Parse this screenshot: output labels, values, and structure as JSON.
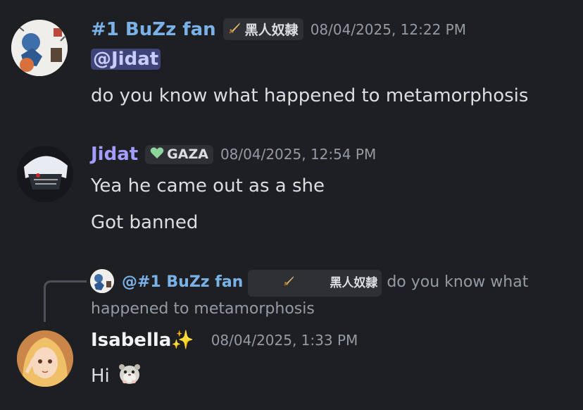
{
  "messages": [
    {
      "author": "#1 BuZz fan",
      "author_color": "#7ab2e8",
      "tag_text": "黑人奴隸",
      "tag_icon": "sword-icon",
      "timestamp": "08/04/2025, 12:22 PM",
      "mention": "@Jidat",
      "lines": [
        "do you know what happened to metamorphosis"
      ]
    },
    {
      "author": "Jidat",
      "author_color": "#a29dff",
      "tag_text": "GAZA",
      "tag_icon": "green-heart-icon",
      "timestamp": "08/04/2025, 12:54 PM",
      "lines": [
        "Yea he came out as a she",
        "Got banned"
      ]
    },
    {
      "author": "Isabella",
      "author_suffix": "✨",
      "author_color": "#f2f3f5",
      "timestamp": "08/04/2025, 1:33 PM",
      "lines": [
        "Hi"
      ],
      "reply": {
        "author": "@#1 BuZz fan",
        "tag_text": "黑人奴隸",
        "tag_icon": "sword-icon",
        "text": "do you know what happened to metamorphosis"
      }
    }
  ]
}
